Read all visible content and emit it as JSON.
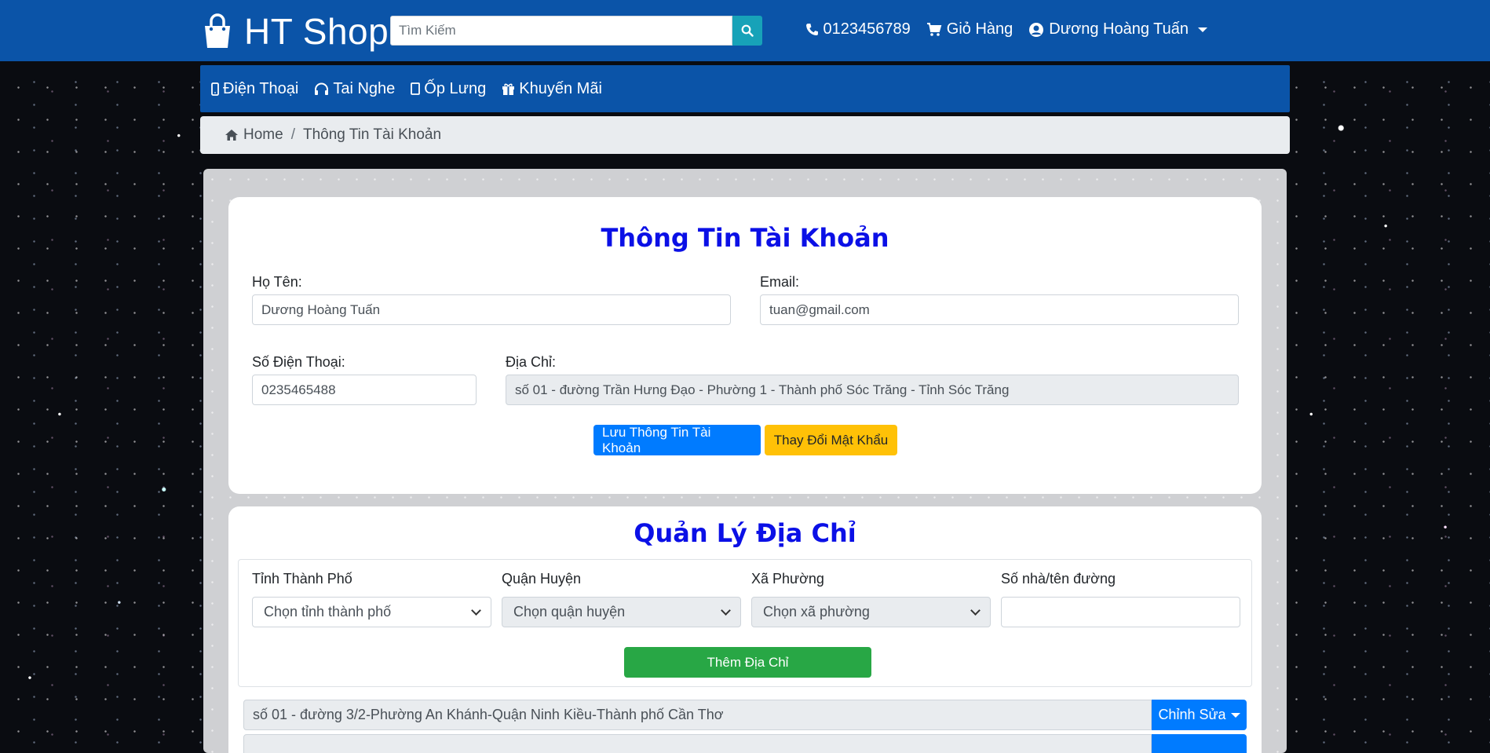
{
  "header": {
    "brand": "HT Shop",
    "search_placeholder": "Tìm Kiếm",
    "phone": "0123456789",
    "cart": "Giỏ Hàng",
    "user": "Dương Hoàng Tuấn"
  },
  "nav": {
    "items": [
      {
        "label": "Điện Thoại",
        "icon": "mobile-icon"
      },
      {
        "label": "Tai Nghe",
        "icon": "headphones-icon"
      },
      {
        "label": "Ốp Lưng",
        "icon": "case-icon"
      },
      {
        "label": "Khuyến Mãi",
        "icon": "gift-icon"
      }
    ]
  },
  "breadcrumb": {
    "home": "Home",
    "current": "Thông Tin Tài Khoản"
  },
  "account": {
    "title": "Thông Tin Tài Khoản",
    "name_label": "Họ Tên:",
    "name_value": "Dương Hoàng Tuấn",
    "email_label": "Email:",
    "email_value": "tuan@gmail.com",
    "phone_label": "Số Điện Thoại:",
    "phone_value": "0235465488",
    "address_label": "Địa Chỉ:",
    "address_value": "số 01 - đường Trần Hưng Đạo - Phường 1 - Thành phố Sóc Trăng - Tỉnh Sóc Trăng",
    "save_button": "Lưu Thông Tin Tài Khoản",
    "change_password_button": "Thay Đổi Mật Khẩu"
  },
  "address_mgmt": {
    "title": "Quản Lý Địa Chỉ",
    "province_label": "Tỉnh Thành Phố",
    "province_value": "Chọn tỉnh thành phố",
    "district_label": "Quận Huyện",
    "district_value": "Chọn quận huyện",
    "ward_label": "Xã Phường",
    "ward_value": "Chọn xã phường",
    "street_label": "Số nhà/tên đường",
    "street_value": "",
    "add_button": "Thêm Địa Chỉ",
    "saved": [
      {
        "address": "số 01 - đường 3/2-Phường An Khánh-Quận Ninh Kiều-Thành phố Cần Thơ",
        "edit": "Chỉnh Sửa"
      },
      {
        "address": "",
        "edit": ""
      }
    ]
  },
  "colors": {
    "brand_blue": "#0b54a8",
    "title_blue": "#0b10e6",
    "primary": "#007bff",
    "warning": "#ffc107",
    "success": "#28a745",
    "search_btn": "#17a2b8"
  }
}
